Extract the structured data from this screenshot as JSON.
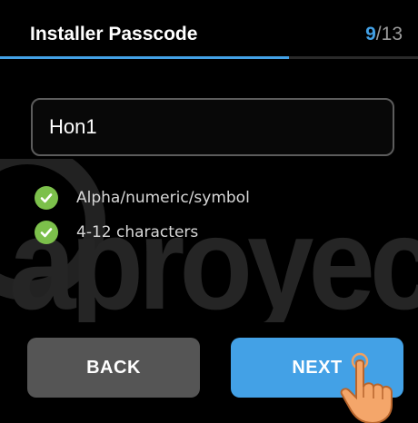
{
  "header": {
    "title": "Installer Passcode",
    "step_current": "9",
    "step_separator": "/",
    "step_total": "13",
    "progress_fraction": 0.6923
  },
  "watermark": {
    "text": "aproyec"
  },
  "passcode": {
    "value": "Hon1"
  },
  "requirements": [
    {
      "label": "Alpha/numeric/symbol",
      "icon": "check-circle-icon",
      "met": true
    },
    {
      "label": "4-12 characters",
      "icon": "check-circle-icon",
      "met": true
    }
  ],
  "buttons": {
    "back_label": "BACK",
    "next_label": "NEXT"
  },
  "colors": {
    "accent": "#43a1e6",
    "check": "#7cc04b",
    "back_button": "#555555",
    "background": "#000000"
  }
}
